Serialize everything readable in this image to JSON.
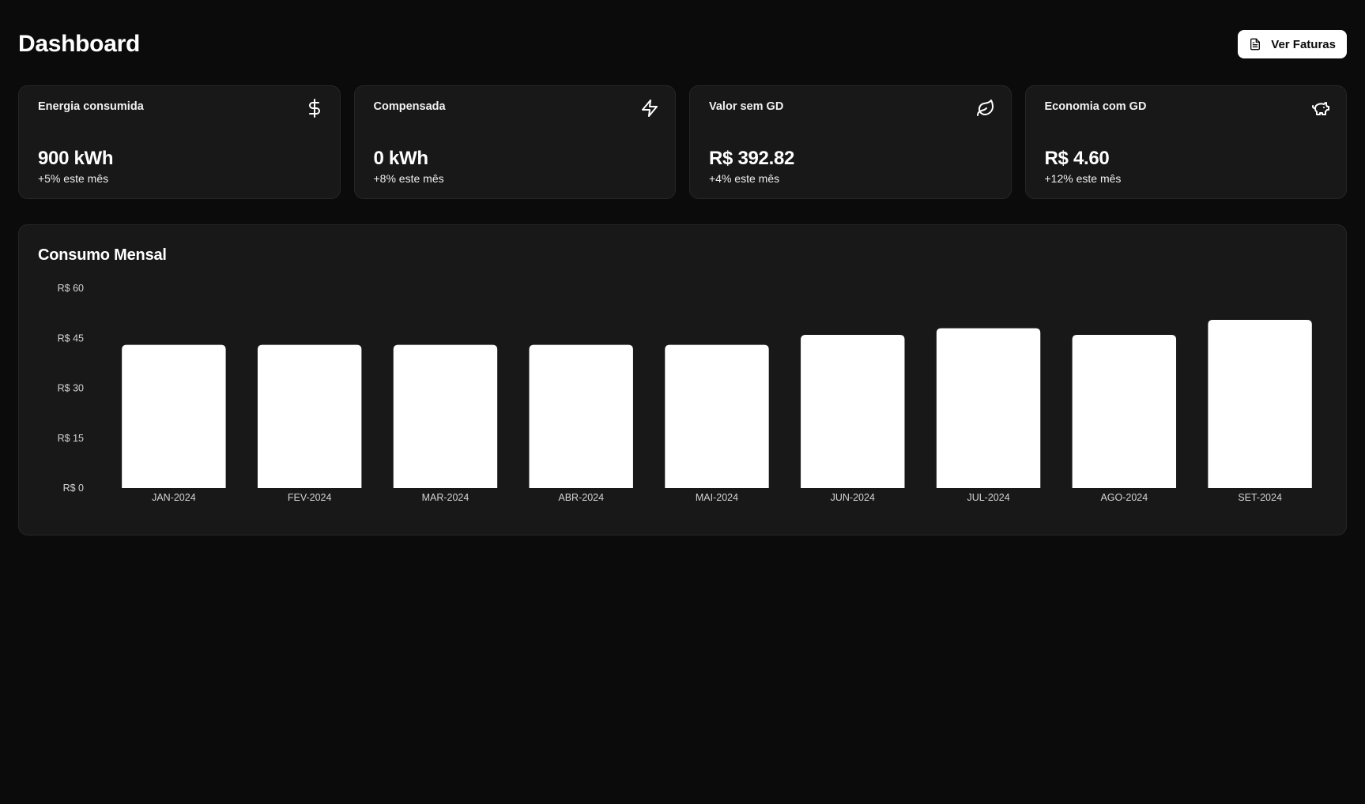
{
  "header": {
    "title": "Dashboard",
    "button_label": "Ver Faturas",
    "button_icon": "file-text-icon"
  },
  "cards": [
    {
      "title": "Energia consumida",
      "value": "900 kWh",
      "delta": "+5% este mês",
      "icon": "dollar-sign-icon"
    },
    {
      "title": "Compensada",
      "value": "0 kWh",
      "delta": "+8% este mês",
      "icon": "zap-icon"
    },
    {
      "title": "Valor sem GD",
      "value": "R$ 392.82",
      "delta": "+4% este mês",
      "icon": "leaf-icon"
    },
    {
      "title": "Economia com GD",
      "value": "R$ 4.60",
      "delta": "+12% este mês",
      "icon": "piggy-bank-icon"
    }
  ],
  "chart": {
    "title": "Consumo Mensal"
  },
  "chart_data": {
    "type": "bar",
    "title": "Consumo Mensal",
    "categories": [
      "JAN-2024",
      "FEV-2024",
      "MAR-2024",
      "ABR-2024",
      "MAI-2024",
      "JUN-2024",
      "JUL-2024",
      "AGO-2024",
      "SET-2024"
    ],
    "values": [
      43,
      43,
      43,
      43,
      43,
      46,
      48,
      46,
      50.5
    ],
    "y_ticks": [
      "R$ 0",
      "R$ 15",
      "R$ 30",
      "R$ 45",
      "R$ 60"
    ],
    "y_tick_values": [
      0,
      15,
      30,
      45,
      60
    ],
    "ylim": [
      0,
      60
    ],
    "bar_color": "#ffffff",
    "grid": false,
    "legend": "none"
  }
}
